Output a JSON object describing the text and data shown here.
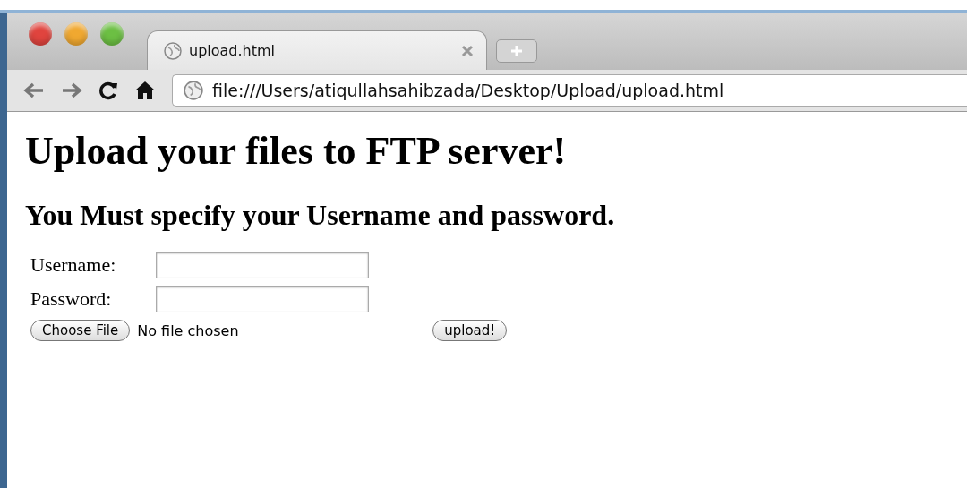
{
  "tab": {
    "title": "upload.html",
    "selected": true
  },
  "address": {
    "value": "file:///Users/atiqullahsahibzada/Desktop/Upload/upload.html"
  },
  "page": {
    "heading": "Upload your files to FTP server!",
    "subheading": "You Must specify your Username and password.",
    "fields": [
      {
        "label": "Username:"
      },
      {
        "label": "Password:"
      }
    ],
    "file_button": "Choose File",
    "file_status": "No file chosen",
    "submit": "upload!"
  }
}
